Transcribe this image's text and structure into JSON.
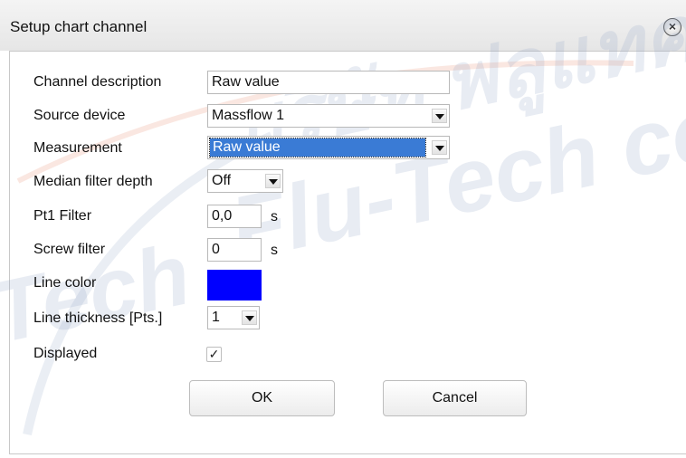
{
  "window": {
    "title": "Setup chart channel",
    "close_icon": "close-icon"
  },
  "watermark": {
    "text_thai": "บริษัท ฟลูแทค",
    "text_latin": "Flu-Tech co",
    "text_left": "Tech"
  },
  "form": {
    "channel_description": {
      "label": "Channel description",
      "value": "Raw value"
    },
    "source_device": {
      "label": "Source device",
      "value": "Massflow 1"
    },
    "measurement": {
      "label": "Measurement",
      "value": "Raw value"
    },
    "median_filter_depth": {
      "label": "Median filter depth",
      "value": "Off"
    },
    "pt1_filter": {
      "label": "Pt1 Filter",
      "value": "0,0",
      "unit": "s"
    },
    "screw_filter": {
      "label": "Screw filter",
      "value": "0",
      "unit": "s"
    },
    "line_color": {
      "label": "Line color",
      "color": "#0000ff"
    },
    "line_thickness": {
      "label": "Line thickness [Pts.]",
      "value": "1"
    },
    "displayed": {
      "label": "Displayed",
      "checked": true,
      "mark": "✓"
    }
  },
  "buttons": {
    "ok": "OK",
    "cancel": "Cancel"
  },
  "colors": {
    "selection": "#3a7bd5",
    "line_color": "#0000ff"
  }
}
